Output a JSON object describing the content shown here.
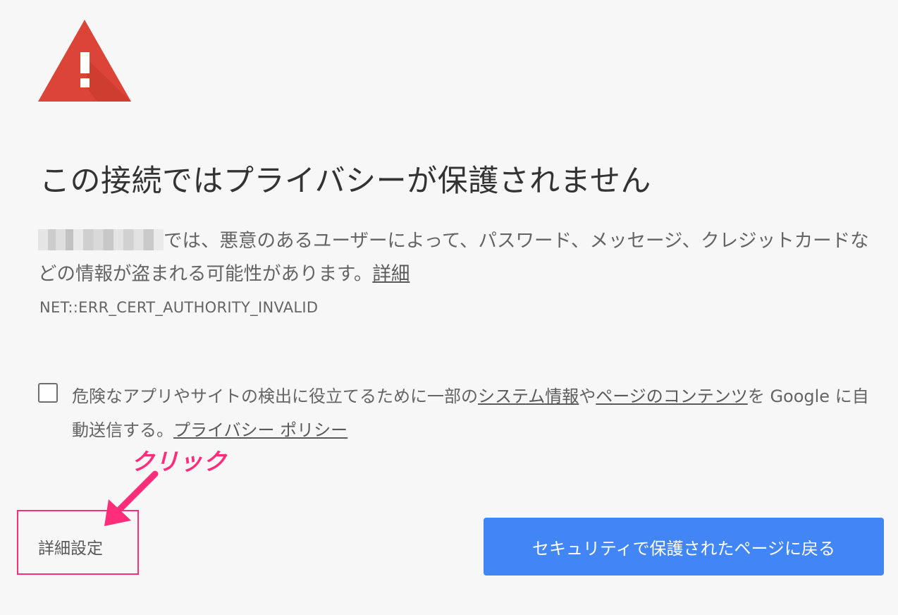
{
  "icons": {
    "warning": "warning-triangle-icon",
    "arrow": "arrow-pointer-icon"
  },
  "colors": {
    "warning_red": "#db4437",
    "primary_blue": "#4285f4",
    "annotation_pink": "#ff2d7a"
  },
  "page": {
    "heading": "この接続ではプライバシーが保護されません",
    "explanation_prefix": "では、悪意のあるユーザーによって、パスワード、メッセージ、クレジットカードなどの情報が盗まれる可能性があります。",
    "explanation_link": "詳細",
    "error_code": "NET::ERR_CERT_AUTHORITY_INVALID"
  },
  "optin": {
    "text_part1": "危険なアプリやサイトの検出に役立てるために一部の",
    "link1": "システム情報",
    "text_part2": "や",
    "link2": "ページのコンテンツ",
    "text_part3": "を Google に自動送信する。",
    "privacy_link": "プライバシー ポリシー"
  },
  "annotation": {
    "label": "クリック"
  },
  "buttons": {
    "details": "詳細設定",
    "back_to_safety": "セキュリティで保護されたページに戻る"
  }
}
